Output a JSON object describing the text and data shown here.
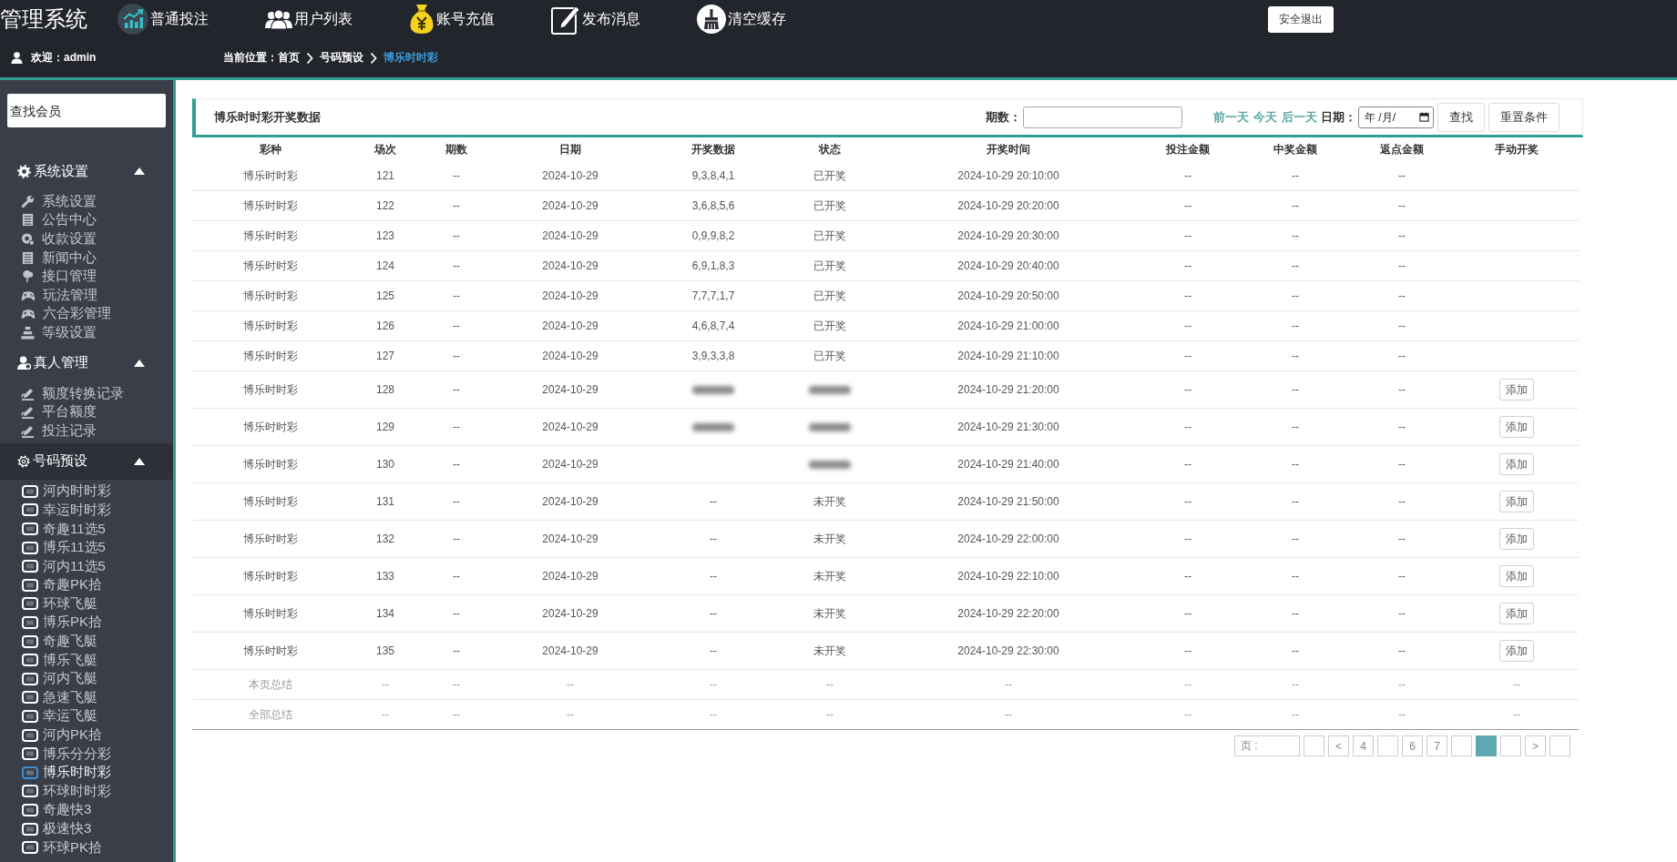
{
  "header": {
    "title": "管理系统",
    "nav": [
      {
        "label": "普通投注"
      },
      {
        "label": "用户列表"
      },
      {
        "label": "账号充值"
      },
      {
        "label": "发布消息"
      },
      {
        "label": "清空缓存"
      }
    ],
    "logout": "安全退出",
    "welcome": "欢迎：admin",
    "location_label": "当前位置：",
    "breadcrumb": [
      {
        "label": "首页",
        "current": false
      },
      {
        "label": "号码预设",
        "current": false
      },
      {
        "label": "博乐时时彩",
        "current": true
      }
    ]
  },
  "sidebar": {
    "search": {
      "placeholder": "查找会员"
    },
    "groups": [
      {
        "label": "系统设置",
        "expanded": true,
        "selected": false,
        "items": [
          {
            "label": "系统设置",
            "selected": false
          },
          {
            "label": "公告中心",
            "selected": false
          },
          {
            "label": "收款设置",
            "selected": false
          },
          {
            "label": "新闻中心",
            "selected": false
          },
          {
            "label": "接口管理",
            "selected": false
          },
          {
            "label": "玩法管理",
            "selected": false
          },
          {
            "label": "六合彩管理",
            "selected": false
          },
          {
            "label": "等级设置",
            "selected": false
          }
        ]
      },
      {
        "label": "真人管理",
        "expanded": true,
        "selected": false,
        "items": [
          {
            "label": "额度转换记录",
            "selected": false
          },
          {
            "label": "平台额度",
            "selected": false
          },
          {
            "label": "投注记录",
            "selected": false
          }
        ]
      },
      {
        "label": "号码预设",
        "expanded": true,
        "selected": true,
        "items": [
          {
            "label": "河内时时彩",
            "selected": false
          },
          {
            "label": "幸运时时彩",
            "selected": false
          },
          {
            "label": "奇趣11选5",
            "selected": false
          },
          {
            "label": "博乐11选5",
            "selected": false
          },
          {
            "label": "河内11选5",
            "selected": false
          },
          {
            "label": "奇趣PK拾",
            "selected": false
          },
          {
            "label": "环球飞艇",
            "selected": false
          },
          {
            "label": "博乐PK拾",
            "selected": false
          },
          {
            "label": "奇趣飞艇",
            "selected": false
          },
          {
            "label": "博乐飞艇",
            "selected": false
          },
          {
            "label": "河内飞艇",
            "selected": false
          },
          {
            "label": "急速飞艇",
            "selected": false
          },
          {
            "label": "幸运飞艇",
            "selected": false
          },
          {
            "label": "河内PK拾",
            "selected": false
          },
          {
            "label": "博乐分分彩",
            "selected": false
          },
          {
            "label": "博乐时时彩",
            "selected": true
          },
          {
            "label": "环球时时彩",
            "selected": false
          },
          {
            "label": "奇趣快3",
            "selected": false
          },
          {
            "label": "极速快3",
            "selected": false
          },
          {
            "label": "环球PK拾",
            "selected": false
          }
        ]
      }
    ]
  },
  "panel": {
    "title": "博乐时时彩开奖数据",
    "issue_label": "期数：",
    "day_links": [
      "前一天",
      "今天",
      "后一天"
    ],
    "date_label": "日期：",
    "date_field": {
      "placeholder": "年 /月/"
    },
    "buttons": [
      "查找",
      "重置条件"
    ]
  },
  "table": {
    "columns": [
      "彩种",
      "场次",
      "期数",
      "日期",
      "开奖数据",
      "状态",
      "开奖时间",
      "投注金额",
      "中奖金额",
      "返点金额",
      "手动开奖"
    ],
    "rows": [
      {
        "cells": [
          "博乐时时彩",
          "121",
          "--",
          "2024-10-29",
          "9,3,8,4,1",
          "已开奖",
          "2024-10-29 20:10:00",
          "--",
          "--",
          "--"
        ]
      },
      {
        "cells": [
          "博乐时时彩",
          "122",
          "--",
          "2024-10-29",
          "3,6,8,5,6",
          "已开奖",
          "2024-10-29 20:20:00",
          "--",
          "--",
          "--"
        ]
      },
      {
        "cells": [
          "博乐时时彩",
          "123",
          "--",
          "2024-10-29",
          "0,9,9,8,2",
          "已开奖",
          "2024-10-29 20:30:00",
          "--",
          "--",
          "--"
        ]
      },
      {
        "cells": [
          "博乐时时彩",
          "124",
          "--",
          "2024-10-29",
          "6,9,1,8,3",
          "已开奖",
          "2024-10-29 20:40:00",
          "--",
          "--",
          "--"
        ]
      },
      {
        "cells": [
          "博乐时时彩",
          "125",
          "--",
          "2024-10-29",
          "7,7,7,1,7",
          "已开奖",
          "2024-10-29 20:50:00",
          "--",
          "--",
          "--"
        ]
      },
      {
        "cells": [
          "博乐时时彩",
          "126",
          "--",
          "2024-10-29",
          "4,6,8,7,4",
          "已开奖",
          "2024-10-29 21:00:00",
          "--",
          "--",
          "--"
        ]
      },
      {
        "cells": [
          "博乐时时彩",
          "127",
          "--",
          "2024-10-29",
          "3,9,3,3,8",
          "已开奖",
          "2024-10-29 21:10:00",
          "--",
          "--",
          "--"
        ]
      },
      {
        "cells": [
          "博乐时时彩",
          "128",
          "--",
          "2024-10-29",
          {
            "blurred": true
          },
          {
            "blurred": true
          },
          "2024-10-29 21:20:00",
          "--",
          "--",
          "--"
        ],
        "action": "添加"
      },
      {
        "cells": [
          "博乐时时彩",
          "129",
          "--",
          "2024-10-29",
          {
            "blurred": true
          },
          {
            "blurred": true
          },
          "2024-10-29 21:30:00",
          "--",
          "--",
          "--"
        ],
        "action": "添加"
      },
      {
        "cells": [
          "博乐时时彩",
          "130",
          "--",
          "2024-10-29",
          null,
          {
            "blurred": true
          },
          "2024-10-29 21:40:00",
          "--",
          "--",
          "--"
        ],
        "action": "添加"
      },
      {
        "cells": [
          "博乐时时彩",
          "131",
          "--",
          "2024-10-29",
          "--",
          "未开奖",
          "2024-10-29 21:50:00",
          "--",
          "--",
          "--"
        ],
        "action": "添加"
      },
      {
        "cells": [
          "博乐时时彩",
          "132",
          "--",
          "2024-10-29",
          "--",
          "未开奖",
          "2024-10-29 22:00:00",
          "--",
          "--",
          "--"
        ],
        "action": "添加"
      },
      {
        "cells": [
          "博乐时时彩",
          "133",
          "--",
          "2024-10-29",
          "--",
          "未开奖",
          "2024-10-29 22:10:00",
          "--",
          "--",
          "--"
        ],
        "action": "添加"
      },
      {
        "cells": [
          "博乐时时彩",
          "134",
          "--",
          "2024-10-29",
          "--",
          "未开奖",
          "2024-10-29 22:20:00",
          "--",
          "--",
          "--"
        ],
        "action": "添加"
      },
      {
        "cells": [
          "博乐时时彩",
          "135",
          "--",
          "2024-10-29",
          "--",
          "未开奖",
          "2024-10-29 22:30:00",
          "--",
          "--",
          "--"
        ],
        "action": "添加"
      }
    ],
    "summary_rows": [
      {
        "cells": [
          "本页总结",
          "--",
          "--",
          "--",
          "--",
          "--",
          "--",
          "--",
          "--",
          "--",
          "--"
        ]
      },
      {
        "cells": [
          "全部总结",
          "--",
          "--",
          "--",
          "--",
          "--",
          "--",
          "--",
          "--",
          "--",
          "--"
        ]
      }
    ]
  },
  "pagination": [
    {
      "label": "页 :",
      "selected": false
    },
    {
      "selected": false
    },
    {
      "label": "<",
      "selected": false
    },
    {
      "label": "4",
      "selected": false
    },
    {
      "selected": false
    },
    {
      "label": "6",
      "selected": false
    },
    {
      "label": "7",
      "selected": false
    },
    {
      "selected": false
    },
    {
      "selected": true
    },
    {
      "selected": false
    },
    {
      "label": ">",
      "selected": false
    },
    {
      "selected": false
    }
  ]
}
